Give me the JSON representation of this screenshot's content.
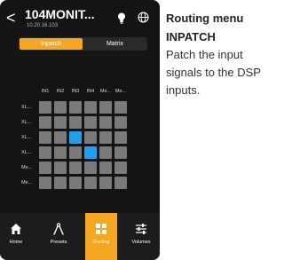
{
  "header": {
    "back_glyph": "<",
    "device_name": "104MONIT...",
    "ip": "10.20.16.103",
    "icons": [
      "lightbulb-icon",
      "globe-icon"
    ]
  },
  "tabs": [
    {
      "label": "Inpatch",
      "active": true
    },
    {
      "label": "Matrix",
      "active": false
    }
  ],
  "grid": {
    "columns": [
      "IN1",
      "IN2",
      "IN3",
      "IN4",
      "Me...",
      "Me..."
    ],
    "rows": [
      "XL...",
      "XL...",
      "XL...",
      "XL...",
      "Me...",
      "Me..."
    ],
    "active_cells": [
      [
        2,
        2
      ],
      [
        3,
        3
      ]
    ]
  },
  "nav": [
    {
      "label": "Home",
      "icon": "home-icon",
      "active": false
    },
    {
      "label": "Presets",
      "icon": "presets-icon",
      "active": false
    },
    {
      "label": "Routing",
      "icon": "routing-icon",
      "active": true
    },
    {
      "label": "Volumes",
      "icon": "volumes-icon",
      "active": false
    }
  ],
  "side": {
    "title": "Routing menu INPATCH",
    "body": "Patch the input signals to the DSP inputs."
  },
  "colors": {
    "accent": "#f5a623",
    "selected": "#1ea0ef",
    "cell": "#7a7a7a",
    "background": "#141414"
  }
}
